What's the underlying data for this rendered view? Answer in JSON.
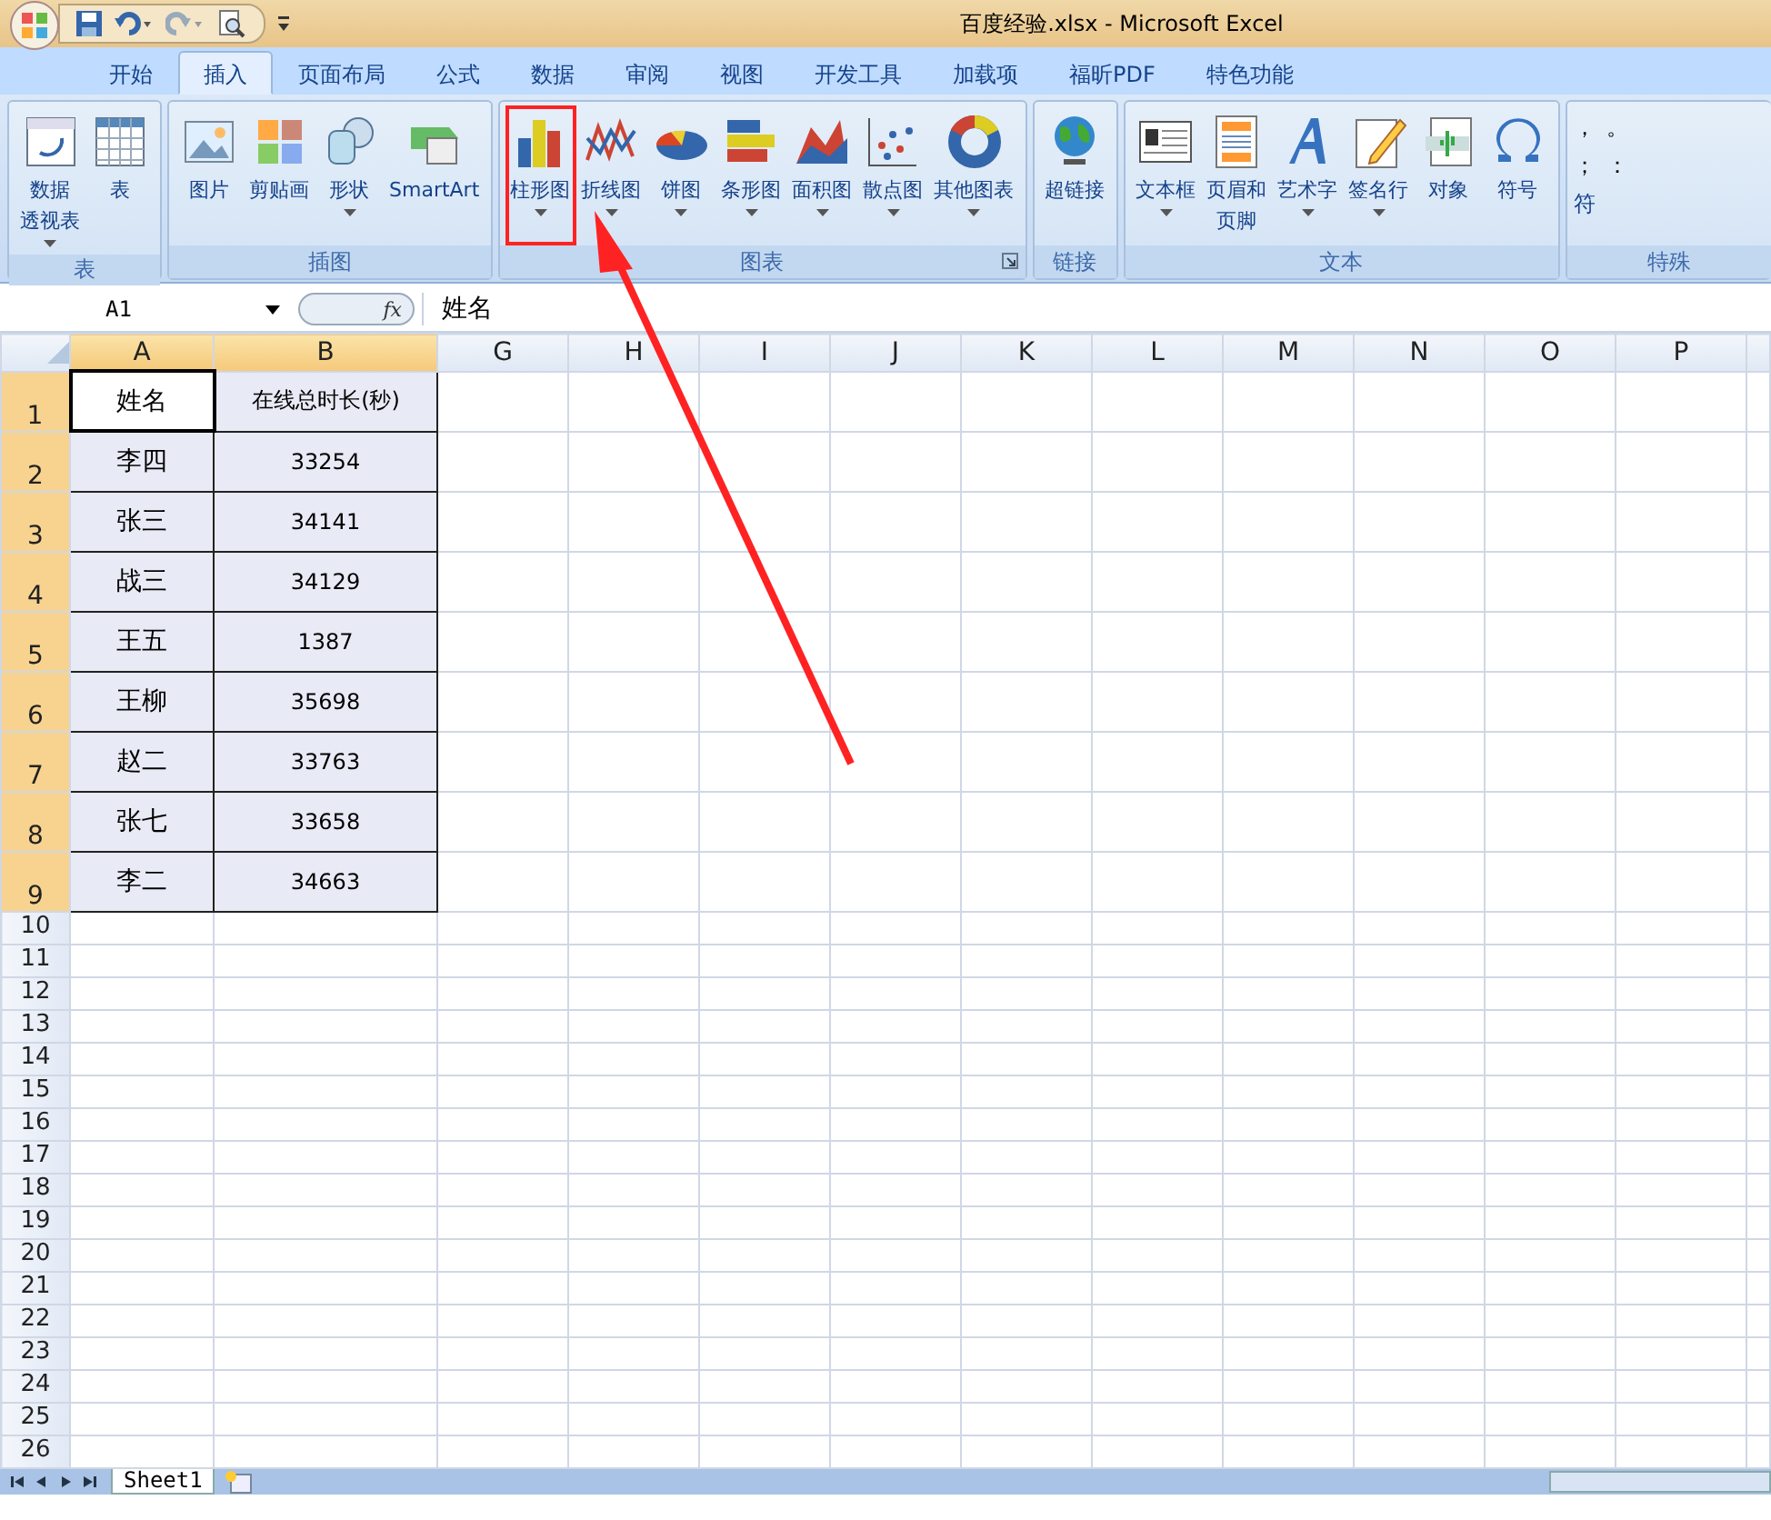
{
  "window": {
    "title": "百度经验.xlsx - Microsoft Excel"
  },
  "tabs": [
    {
      "label": "开始",
      "selected": false
    },
    {
      "label": "插入",
      "selected": true
    },
    {
      "label": "页面布局",
      "selected": false
    },
    {
      "label": "公式",
      "selected": false
    },
    {
      "label": "数据",
      "selected": false
    },
    {
      "label": "审阅",
      "selected": false
    },
    {
      "label": "视图",
      "selected": false
    },
    {
      "label": "开发工具",
      "selected": false
    },
    {
      "label": "加载项",
      "selected": false
    },
    {
      "label": "福昕PDF",
      "selected": false
    },
    {
      "label": "特色功能",
      "selected": false
    }
  ],
  "ribbon_groups": [
    {
      "label": "表",
      "buttons": [
        {
          "lines": [
            "数据",
            "透视表"
          ],
          "dropdown": true,
          "highlighted": false
        },
        {
          "label": "表",
          "dropdown": false,
          "highlighted": false
        }
      ]
    },
    {
      "label": "插图",
      "buttons": [
        {
          "label": "图片",
          "dropdown": false,
          "highlighted": false
        },
        {
          "label": "剪贴画",
          "dropdown": false,
          "highlighted": false
        },
        {
          "label": "形状",
          "dropdown": true,
          "highlighted": false
        },
        {
          "label": "SmartArt",
          "dropdown": false,
          "highlighted": false
        }
      ]
    },
    {
      "label": "图表",
      "launcher": true,
      "buttons": [
        {
          "label": "柱形图",
          "dropdown": true,
          "highlighted": true
        },
        {
          "label": "折线图",
          "dropdown": true,
          "highlighted": false
        },
        {
          "label": "饼图",
          "dropdown": true,
          "highlighted": false
        },
        {
          "label": "条形图",
          "dropdown": true,
          "highlighted": false
        },
        {
          "label": "面积图",
          "dropdown": true,
          "highlighted": false
        },
        {
          "label": "散点图",
          "dropdown": true,
          "highlighted": false
        },
        {
          "label": "其他图表",
          "dropdown": true,
          "highlighted": false
        }
      ]
    },
    {
      "label": "链接",
      "buttons": [
        {
          "label": "超链接",
          "dropdown": false,
          "highlighted": false
        }
      ]
    },
    {
      "label": "文本",
      "buttons": [
        {
          "label": "文本框",
          "dropdown": true,
          "highlighted": false
        },
        {
          "lines": [
            "页眉和",
            "页脚"
          ],
          "dropdown": false,
          "highlighted": false
        },
        {
          "label": "艺术字",
          "dropdown": true,
          "highlighted": false
        },
        {
          "label": "签名行",
          "dropdown": true,
          "highlighted": false
        },
        {
          "label": "对象",
          "dropdown": false,
          "highlighted": false
        },
        {
          "label": "符号",
          "dropdown": false,
          "highlighted": false
        }
      ]
    }
  ],
  "special_symbols": {
    "marks": [
      "，",
      "。",
      "；",
      "："
    ],
    "button": "符",
    "group_label": "特殊"
  },
  "name_box": "A1",
  "function_button": "fx",
  "formula": "姓名",
  "columns": [
    {
      "label": "A",
      "selected": true
    },
    {
      "label": "B",
      "selected": true
    },
    {
      "label": "G",
      "selected": false
    },
    {
      "label": "H",
      "selected": false
    },
    {
      "label": "I",
      "selected": false
    },
    {
      "label": "J",
      "selected": false
    },
    {
      "label": "K",
      "selected": false
    },
    {
      "label": "L",
      "selected": false
    },
    {
      "label": "M",
      "selected": false
    },
    {
      "label": "N",
      "selected": false
    },
    {
      "label": "O",
      "selected": false
    },
    {
      "label": "P",
      "selected": false
    }
  ],
  "rows": [
    {
      "number": "1",
      "selected": true,
      "cells": [
        {
          "text": "姓名",
          "active": true
        },
        {
          "text": "在线总时长(秒)",
          "active": false
        }
      ]
    },
    {
      "number": "2",
      "selected": true,
      "cells": [
        {
          "text": "李四",
          "active": false
        },
        {
          "text": "33254",
          "active": false
        }
      ]
    },
    {
      "number": "3",
      "selected": true,
      "cells": [
        {
          "text": "张三",
          "active": false
        },
        {
          "text": "34141",
          "active": false
        }
      ]
    },
    {
      "number": "4",
      "selected": true,
      "cells": [
        {
          "text": "战三",
          "active": false
        },
        {
          "text": "34129",
          "active": false
        }
      ]
    },
    {
      "number": "5",
      "selected": true,
      "cells": [
        {
          "text": "王五",
          "active": false
        },
        {
          "text": "1387",
          "active": false
        }
      ]
    },
    {
      "number": "6",
      "selected": true,
      "cells": [
        {
          "text": "王柳",
          "active": false
        },
        {
          "text": "35698",
          "active": false
        }
      ]
    },
    {
      "number": "7",
      "selected": true,
      "cells": [
        {
          "text": "赵二",
          "active": false
        },
        {
          "text": "33763",
          "active": false
        }
      ]
    },
    {
      "number": "8",
      "selected": true,
      "cells": [
        {
          "text": "张七",
          "active": false
        },
        {
          "text": "33658",
          "active": false
        }
      ]
    },
    {
      "number": "9",
      "selected": true,
      "cells": [
        {
          "text": "李二",
          "active": false
        },
        {
          "text": "34663",
          "active": false
        }
      ]
    },
    {
      "number": "10",
      "selected": false
    },
    {
      "number": "11",
      "selected": false
    },
    {
      "number": "12",
      "selected": false
    },
    {
      "number": "13",
      "selected": false
    },
    {
      "number": "14",
      "selected": false
    },
    {
      "number": "15",
      "selected": false
    },
    {
      "number": "16",
      "selected": false
    },
    {
      "number": "17",
      "selected": false
    },
    {
      "number": "18",
      "selected": false
    },
    {
      "number": "19",
      "selected": false
    },
    {
      "number": "20",
      "selected": false
    },
    {
      "number": "21",
      "selected": false
    },
    {
      "number": "22",
      "selected": false
    },
    {
      "number": "23",
      "selected": false
    },
    {
      "number": "24",
      "selected": false
    },
    {
      "number": "25",
      "selected": false
    },
    {
      "number": "26",
      "selected": false
    }
  ],
  "sheet_tabs": [
    {
      "label": "Sheet1",
      "selected": true
    }
  ]
}
